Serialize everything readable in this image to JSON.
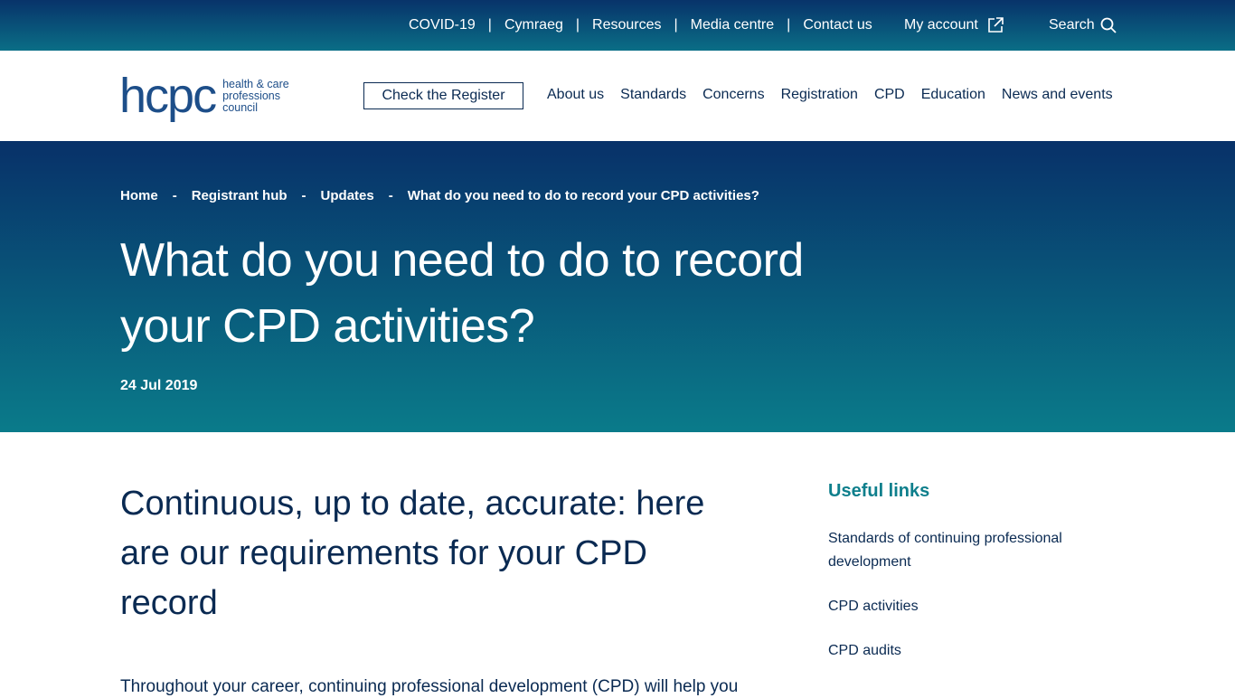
{
  "top_nav": {
    "items": [
      "COVID-19",
      "Cymraeg",
      "Resources",
      "Media centre",
      "Contact us"
    ],
    "separator": "|",
    "my_account": "My account",
    "search": "Search"
  },
  "header": {
    "logo_mark": "hcpc",
    "logo_lines": [
      "health & care",
      "professions",
      "council"
    ],
    "check_register": "Check the Register",
    "nav": [
      "About us",
      "Standards",
      "Concerns",
      "Registration",
      "CPD",
      "Education",
      "News and events"
    ]
  },
  "hero": {
    "breadcrumbs": [
      "Home",
      "Registrant hub",
      "Updates",
      "What do you need to do to record your CPD activities?"
    ],
    "crumb_sep": "-",
    "title": "What do you need to do to record your CPD activities?",
    "date": "24 Jul 2019"
  },
  "content": {
    "lead": "Continuous, up to date, accurate: here are our requirements for your CPD record",
    "paragraph": "Throughout your career, continuing professional development (CPD) will help you"
  },
  "sidebar": {
    "heading": "Useful links",
    "links": [
      "Standards of continuing professional development",
      "CPD activities",
      "CPD audits"
    ]
  },
  "colors": {
    "navy": "#0a2a52",
    "teal_accent": "#0e7f8c",
    "hero_top": "#083169",
    "hero_bottom": "#0a7b8a"
  }
}
